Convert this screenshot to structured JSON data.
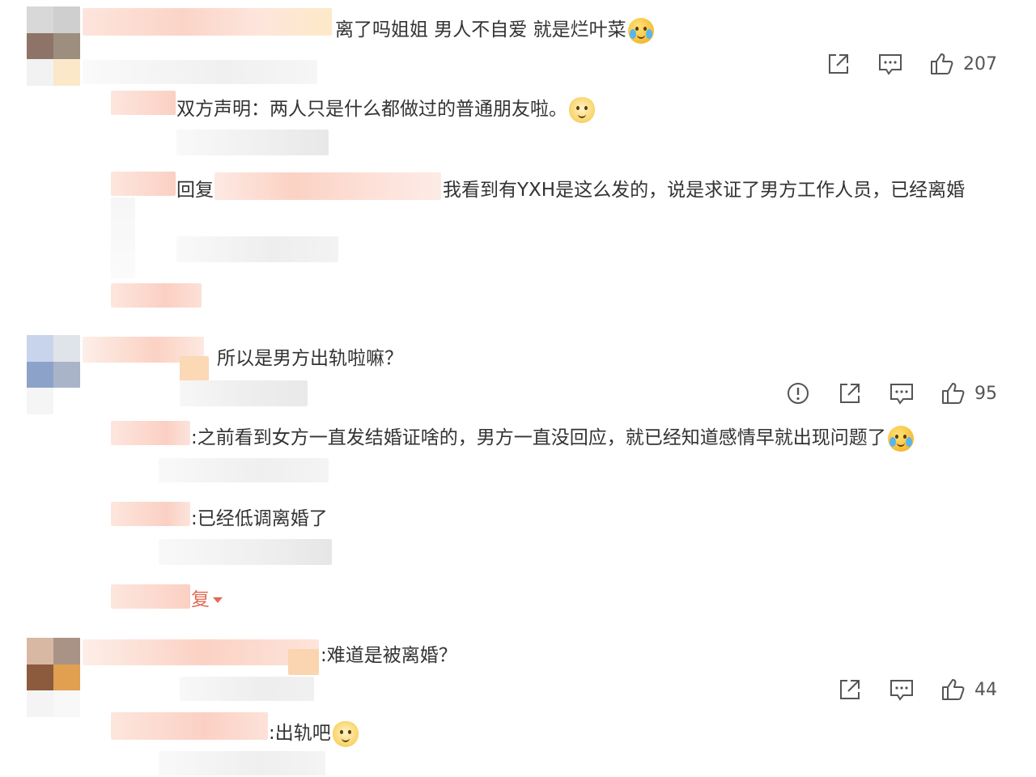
{
  "comments": [
    {
      "text": "离了吗姐姐 男人不自爱 就是烂叶菜",
      "likes": "207",
      "emoji": "crying-face-icon"
    },
    {
      "text": "所以是男方出轨啦嘛？",
      "likes": "95"
    },
    {
      "text": ":难道是被离婚？",
      "likes": "44"
    }
  ],
  "replies": [
    {
      "text": "双方声明：两人只是什么都做过的普通朋友啦。",
      "emoji": "dog-face-icon"
    },
    {
      "prefix": "回复",
      "text": "我看到有YXH是这么发的，说是求证了男方工作人员，已经离婚"
    },
    {
      "text": ":之前看到女方一直发结婚证啥的，男方一直没回应，就已经知道感情早就出现问题了",
      "emoji": "laughing-crying-icon"
    },
    {
      "text": ":已经低调离婚了"
    },
    {
      "text": "复",
      "note_partial": true
    },
    {
      "text": ":出轨吧",
      "emoji": "dog-face-icon"
    }
  ],
  "colors": {
    "text": "#333333",
    "icon": "#555555",
    "accent": "#e36b55",
    "mosaic_peach": "#fbd9cc",
    "mosaic_grey": "#e6e6e6"
  },
  "icons": [
    "share-icon",
    "comment-icon",
    "like-icon",
    "report-icon"
  ]
}
